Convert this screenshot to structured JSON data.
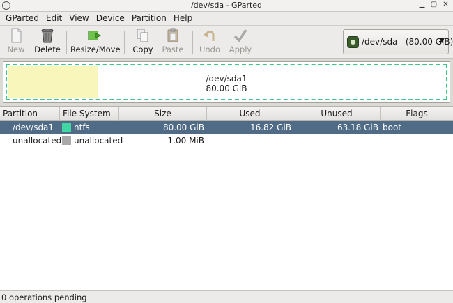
{
  "window": {
    "title": "/dev/sda - GParted"
  },
  "menu": [
    {
      "pre": "",
      "ul": "G",
      "post": "Parted"
    },
    {
      "pre": "",
      "ul": "E",
      "post": "dit"
    },
    {
      "pre": "",
      "ul": "V",
      "post": "iew"
    },
    {
      "pre": "",
      "ul": "D",
      "post": "evice"
    },
    {
      "pre": "",
      "ul": "P",
      "post": "artition"
    },
    {
      "pre": "",
      "ul": "H",
      "post": "elp"
    }
  ],
  "toolbar": {
    "new": "New",
    "delete": "Delete",
    "resize_move": "Resize/Move",
    "copy": "Copy",
    "paste": "Paste",
    "undo": "Undo",
    "apply": "Apply"
  },
  "device_selector": {
    "label": "/dev/sda   (80.00 GiB)",
    "icon": "disk-icon"
  },
  "disk_map": {
    "partition": "/dev/sda1",
    "size": "80.00 GiB",
    "used_fraction": 0.21,
    "colors": {
      "border": "#3fc78a",
      "used": "#f8f6bb"
    }
  },
  "table": {
    "headers": [
      "Partition",
      "File System",
      "Size",
      "Used",
      "Unused",
      "Flags"
    ],
    "rows": [
      {
        "partition": "/dev/sda1",
        "fs": "ntfs",
        "fs_color": "#42d6a4",
        "size": "80.00 GiB",
        "used": "16.82 GiB",
        "unused": "63.18 GiB",
        "flags": "boot",
        "selected": true
      },
      {
        "partition": "unallocated",
        "fs": "unallocated",
        "fs_color": "#a9a9a9",
        "size": "1.00 MiB",
        "used": "---",
        "unused": "---",
        "flags": "",
        "selected": false
      }
    ]
  },
  "status": {
    "text": "0 operations pending"
  },
  "colors": {
    "selection": "#4f6b86"
  }
}
